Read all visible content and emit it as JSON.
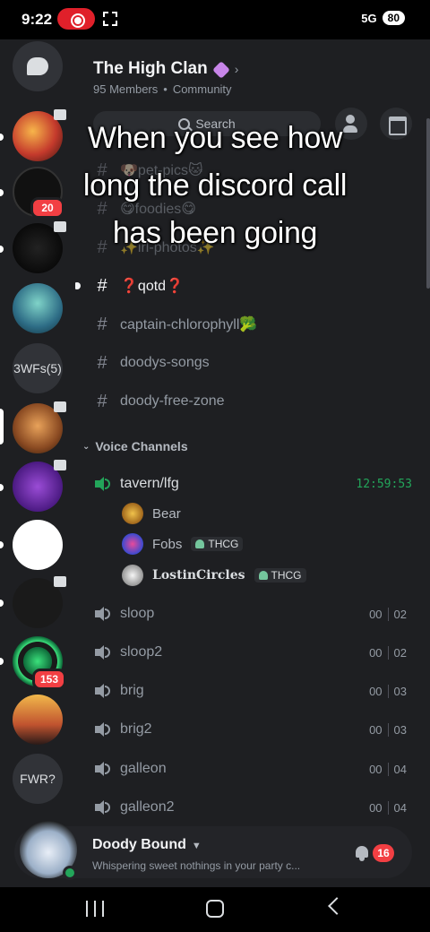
{
  "status_bar": {
    "time": "9:22",
    "network": "5G",
    "battery": "80"
  },
  "server": {
    "name": "The High Clan",
    "members": "95 Members",
    "type": "Community"
  },
  "search": {
    "label": "Search"
  },
  "rail": {
    "folder_label": "3WFs(5)",
    "fwr_label": "FWR?",
    "badge_savage": "20",
    "badge_green": "153"
  },
  "text_channels": [
    {
      "name": "🐶pet-pics🐱"
    },
    {
      "name": "😋foodies😋"
    },
    {
      "name": "✨irl-photos✨"
    },
    {
      "name": "❓qotd❓"
    },
    {
      "name": "captain-chlorophyll🥦"
    },
    {
      "name": "doodys-songs"
    },
    {
      "name": "doody-free-zone"
    }
  ],
  "voice_section": {
    "title": "Voice Channels"
  },
  "voice_channels": [
    {
      "name": "tavern/lfg",
      "timer": "12:59:53"
    },
    {
      "name": "sloop",
      "count_a": "00",
      "count_b": "02"
    },
    {
      "name": "sloop2",
      "count_a": "00",
      "count_b": "02"
    },
    {
      "name": "brig",
      "count_a": "00",
      "count_b": "03"
    },
    {
      "name": "brig2",
      "count_a": "00",
      "count_b": "03"
    },
    {
      "name": "galleon",
      "count_a": "00",
      "count_b": "04"
    },
    {
      "name": "galleon2",
      "count_a": "00",
      "count_b": "04"
    }
  ],
  "voice_users": [
    {
      "name": "Bear",
      "tag": ""
    },
    {
      "name": "Fobs",
      "tag": "THCG"
    },
    {
      "name": "LostinCircles",
      "tag": "THCG"
    }
  ],
  "overlay_caption": [
    "When you see how",
    "long the discord call",
    "has been going"
  ],
  "user": {
    "name": "Doody Bound",
    "status": "Whispering sweet nothings in your party c...",
    "notifications": "16"
  },
  "colors": {
    "accent_green": "#23a55a",
    "badge_red": "#f23f43",
    "background": "#1e1f22"
  }
}
